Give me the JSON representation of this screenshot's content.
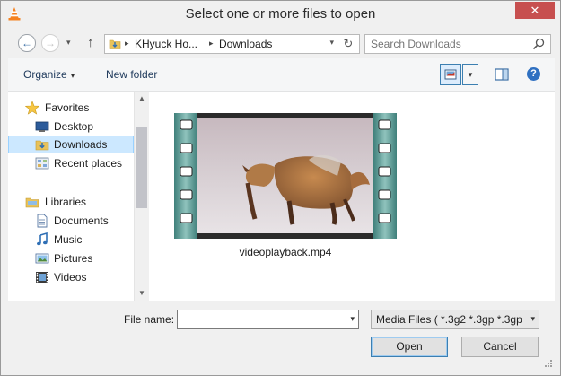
{
  "window": {
    "title": "Select one or more files to open",
    "close_glyph": "✕",
    "app_icon": "vlc-cone-icon"
  },
  "navigation": {
    "back_glyph": "←",
    "forward_glyph": "→",
    "history_drop_glyph": "▾",
    "up_glyph": "↑",
    "breadcrumb": [
      "KHyuck Ho...",
      "Downloads"
    ],
    "breadcrumb_separator": "▸",
    "refresh_glyph": "↻",
    "search_placeholder": "Search Downloads"
  },
  "toolbar": {
    "organize_label": "Organize",
    "new_folder_label": "New folder",
    "caret_glyph": "▾",
    "help_glyph": "?"
  },
  "sidebar": {
    "groups": [
      {
        "label": "Favorites",
        "icon": "star-icon",
        "items": [
          {
            "label": "Desktop",
            "icon": "desktop-icon"
          },
          {
            "label": "Downloads",
            "icon": "downloads-folder-icon",
            "selected": true
          },
          {
            "label": "Recent places",
            "icon": "recent-places-icon"
          }
        ]
      },
      {
        "label": "Libraries",
        "icon": "libraries-icon",
        "items": [
          {
            "label": "Documents",
            "icon": "documents-icon"
          },
          {
            "label": "Music",
            "icon": "music-icon"
          },
          {
            "label": "Pictures",
            "icon": "pictures-icon"
          },
          {
            "label": "Videos",
            "icon": "videos-icon"
          }
        ]
      }
    ],
    "scroll_up_glyph": "▲",
    "scroll_down_glyph": "▼"
  },
  "files": [
    {
      "name": "videoplayback.mp4",
      "thumbnail": "video-filmstrip-thumbnail"
    }
  ],
  "footer": {
    "file_name_label": "File name:",
    "file_name_value": "",
    "file_type_selected": "Media Files ( *.3g2 *.3gp *.3gp2",
    "open_label": "Open",
    "cancel_label": "Cancel",
    "drop_glyph": "▾"
  },
  "colors": {
    "selection_fill": "#cce8ff",
    "selection_border": "#99d1ff",
    "close_button": "#c75050",
    "accent_blue": "#3c7fb1"
  }
}
